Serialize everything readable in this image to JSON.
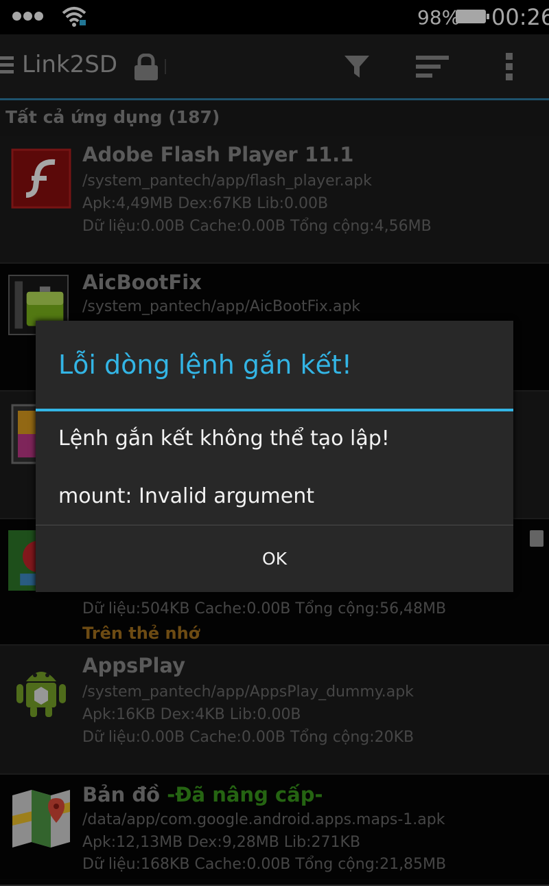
{
  "status_bar": {
    "battery": "98%",
    "time": "00:26"
  },
  "action_bar": {
    "title": "Link2SD",
    "icons": [
      "menu-icon",
      "lock-icon",
      "filter-icon",
      "sort-icon",
      "overflow-menu-icon"
    ]
  },
  "subheader": "Tất cả ứng dụng (187)",
  "apps": [
    {
      "name": "Adobe Flash Player 11.1",
      "path": "/system_pantech/app/flash_player.apk",
      "sizes": "Apk:4,49MB  Dex:67KB  Lib:0.00B",
      "data": "Dữ liệu:0.00B  Cache:0.00B  Tổng cộng:4,56MB",
      "icon": "flash-player-icon"
    },
    {
      "name": "AicBootFix",
      "path": "/system_pantech/app/AicBootFix.apk",
      "icon": "battery-app-icon"
    },
    {
      "icon": "gallery-app-icon"
    },
    {
      "data": "Dữ liệu:504KB  Cache:0.00B  Tổng cộng:56,48MB",
      "location": "Trên thẻ nhớ",
      "icon": "game-app-icon"
    },
    {
      "name": "AppsPlay",
      "path": "/system_pantech/app/AppsPlay_dummy.apk",
      "sizes": "Apk:16KB  Dex:4KB  Lib:0.00B",
      "data": "Dữ liệu:0.00B  Cache:0.00B  Tổng cộng:20KB",
      "icon": "android-icon"
    },
    {
      "name": "Bản đồ",
      "tag": "-Đã nâng cấp-",
      "path": "/data/app/com.google.android.apps.maps-1.apk",
      "sizes": "Apk:12,13MB  Dex:9,28MB  Lib:271KB",
      "data": "Dữ liệu:168KB  Cache:0.00B  Tổng cộng:21,85MB",
      "icon": "maps-icon"
    }
  ],
  "dialog": {
    "title": "Lỗi dòng lệnh gắn kết!",
    "message": "Lệnh gắn kết không thể tạo lập!",
    "detail": "mount: Invalid argument",
    "ok": "OK"
  }
}
